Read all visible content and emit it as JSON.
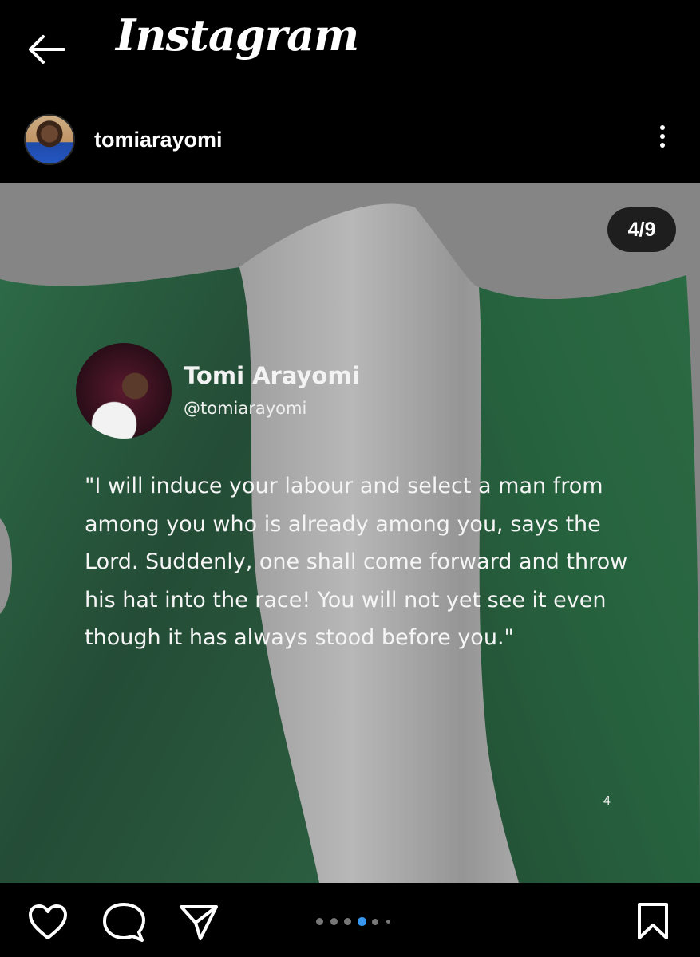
{
  "app": {
    "title": "Instagram"
  },
  "post": {
    "username": "tomiarayomi",
    "slide_counter": "4/9",
    "current_slide": 4,
    "total_slides": 9,
    "card": {
      "name": "Tomi Arayomi",
      "handle": "@tomiarayomi",
      "quote": "\"I will induce your labour and select a man from among you who is already among you, says the Lord. Suddenly, one shall come forward and throw his hat into the race! You will not yet see it even though it has always stood before you.\"",
      "page_number": "4"
    }
  },
  "icons": {
    "back": "back-arrow-icon",
    "more": "more-vertical-icon",
    "like": "heart-icon",
    "comment": "comment-bubble-icon",
    "share": "send-icon",
    "save": "bookmark-icon"
  },
  "colors": {
    "background": "#000000",
    "flag_green": "#1d5a36",
    "flag_white": "#bdbdbd",
    "overlay_gray": "#8a8a8a",
    "active_dot": "#3897f0"
  }
}
